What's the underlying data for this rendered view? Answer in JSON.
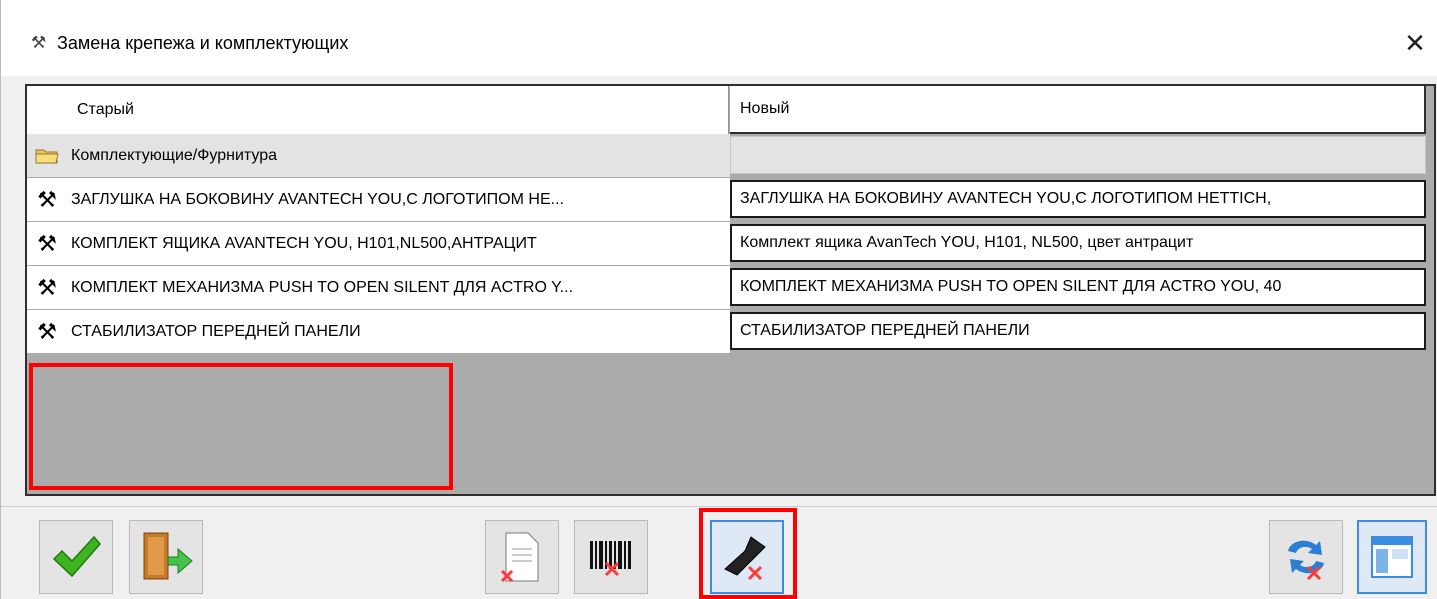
{
  "window": {
    "title": "Замена крепежа и комплектующих",
    "title_icon": "fastener-swap-icon",
    "close_label": "✕"
  },
  "grid": {
    "columns": [
      "Старый",
      "Новый"
    ],
    "group_row": {
      "label": "Комплектующие/Фурнитура",
      "icon": "folder-icon"
    },
    "rows": [
      {
        "icon": "tools-icon",
        "old": "ЗАГЛУШКА НА БОКОВИНУ AVANTECH YOU,С ЛОГОТИПОМ НЕ...",
        "new": "ЗАГЛУШКА НА БОКОВИНУ AVANTECH YOU,С ЛОГОТИПОМ HETTICH,"
      },
      {
        "icon": "tools-icon",
        "old": "КОМПЛЕКТ ЯЩИКА AVANTECH YOU, H101,NL500,АНТРАЦИТ",
        "new": "Комплект ящика AvanTech YOU, H101, NL500, цвет антрацит"
      },
      {
        "icon": "tools-icon",
        "old": "КОМПЛЕКТ МЕХАНИЗМА PUSH TO OPEN SILENT ДЛЯ ACTRO Y...",
        "new": "КОМПЛЕКТ МЕХАНИЗМА PUSH TO OPEN SILENT ДЛЯ ACTRO YOU, 40"
      },
      {
        "icon": "tools-icon",
        "old": "СТАБИЛИЗАТОР ПЕРЕДНЕЙ ПАНЕЛИ",
        "new": "СТАБИЛИЗАТОР ПЕРЕДНЕЙ ПАНЕЛИ"
      }
    ]
  },
  "toolbar": {
    "buttons": [
      {
        "name": "ok-button",
        "icon": "checkmark-icon"
      },
      {
        "name": "exit-button",
        "icon": "door-exit-icon"
      },
      {
        "name": "clear-document-button",
        "icon": "document-delete-icon"
      },
      {
        "name": "clear-barcode-button",
        "icon": "barcode-delete-icon"
      },
      {
        "name": "clear-fastener-button",
        "icon": "fastener-delete-icon"
      },
      {
        "name": "replace-cancel-button",
        "icon": "swap-cancel-icon"
      },
      {
        "name": "window-layout-button",
        "icon": "window-layout-icon"
      }
    ]
  },
  "colors": {
    "grid_background": "#ababab",
    "highlight": "#ff0000",
    "selected_button": "#3a8de0",
    "check_green": "#3cb521"
  }
}
